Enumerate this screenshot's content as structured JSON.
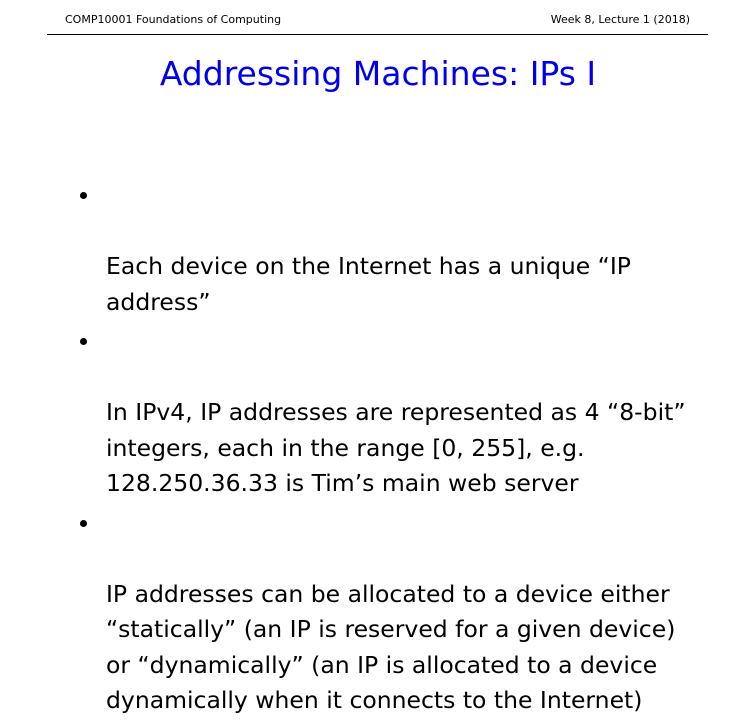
{
  "header": {
    "course": "COMP10001 Foundations of Computing",
    "lecture": "Week 8, Lecture 1 (2018)"
  },
  "title": "Addressing Machines: IPs I",
  "colors": {
    "title": "#0000ee",
    "text": "#000000",
    "background": "#ffffff"
  },
  "bullets": [
    "Each device on the Internet has a unique “IP\naddress”",
    "In IPv4, IP addresses are represented as 4 “8-bit”\nintegers, each in the range [0, 255], e.g.\n128.250.36.33 is Tim’s main web server",
    "IP addresses can be allocated to a device either\n“statically” (an IP is reserved for a given device)\nor “dynamically” (an IP is allocated to a device\ndynamically when it connects to the Internet)"
  ]
}
